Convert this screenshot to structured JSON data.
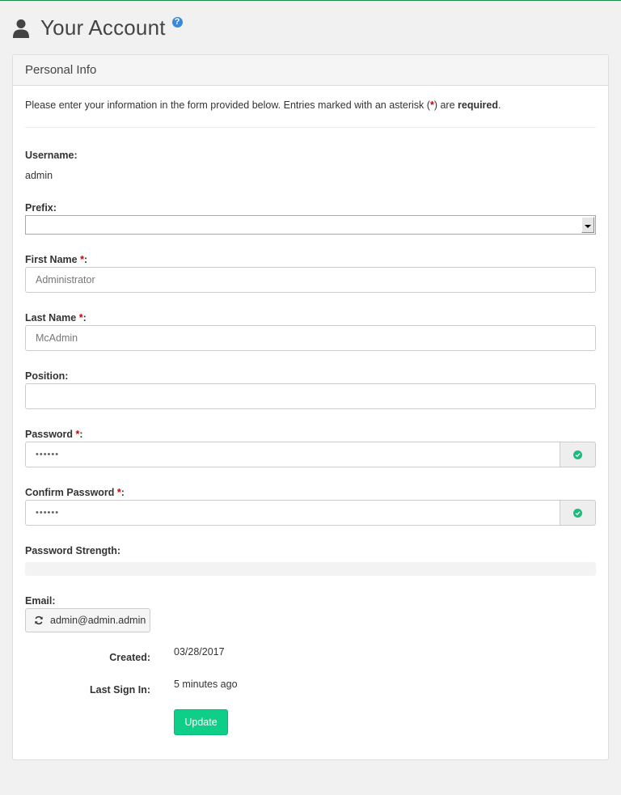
{
  "header": {
    "title": "Your Account",
    "icon": "user-icon",
    "help": "?"
  },
  "panel": {
    "title": "Personal Info",
    "intro": {
      "before": "Please enter your information in the form provided below. Entries marked with an asterisk (",
      "asterisk": "*",
      "middle": ") are ",
      "bold": "required",
      "after": "."
    }
  },
  "form": {
    "username": {
      "label": "Username:",
      "value": "admin"
    },
    "prefix": {
      "label": "Prefix:",
      "value": ""
    },
    "first_name": {
      "label": "First Name",
      "required": "*",
      "colon": ":",
      "placeholder": "Administrator"
    },
    "last_name": {
      "label": "Last Name",
      "required": "*",
      "colon": ":",
      "placeholder": "McAdmin"
    },
    "position": {
      "label": "Position:",
      "value": ""
    },
    "password": {
      "label": "Password",
      "required": "*",
      "colon": ":",
      "value": "••••••"
    },
    "confirm_password": {
      "label": "Confirm Password",
      "required": "*",
      "colon": ":",
      "value": "••••••"
    },
    "strength": {
      "label": "Password Strength:",
      "level": 0
    },
    "email": {
      "label": "Email:",
      "value": "admin@admin.admin"
    },
    "created": {
      "label": "Created:",
      "value": "03/28/2017"
    },
    "last_sign_in": {
      "label": "Last Sign In:",
      "value": "5 minutes ago"
    },
    "update_label": "Update"
  },
  "colors": {
    "accent": "#0fce88",
    "required": "#cc0000",
    "help": "#3b8ad9"
  }
}
